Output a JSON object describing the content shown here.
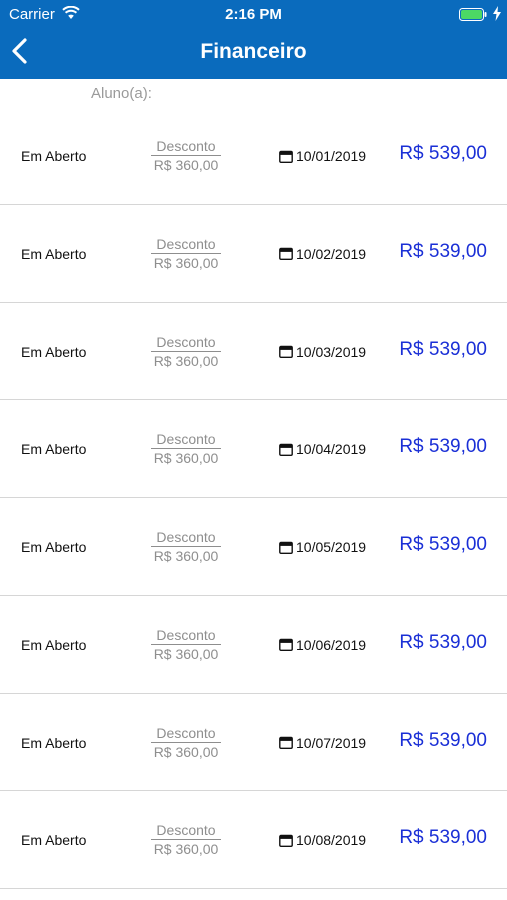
{
  "status_bar": {
    "carrier": "Carrier",
    "time": "2:16 PM"
  },
  "nav": {
    "title": "Financeiro"
  },
  "student": {
    "label": "Aluno(a):",
    "value": ""
  },
  "colors": {
    "header": "#0a6bbd",
    "amount": "#1a2fd6",
    "muted": "#8e8e8e"
  },
  "icons": [
    "wifi-icon",
    "battery-icon",
    "charge-icon",
    "back-icon",
    "calendar-icon"
  ],
  "payments": [
    {
      "status": "Em Aberto",
      "discount_label": "Desconto",
      "discount_value": "R$ 360,00",
      "date": "10/01/2019",
      "amount": "R$ 539,00"
    },
    {
      "status": "Em Aberto",
      "discount_label": "Desconto",
      "discount_value": "R$ 360,00",
      "date": "10/02/2019",
      "amount": "R$ 539,00"
    },
    {
      "status": "Em Aberto",
      "discount_label": "Desconto",
      "discount_value": "R$ 360,00",
      "date": "10/03/2019",
      "amount": "R$ 539,00"
    },
    {
      "status": "Em Aberto",
      "discount_label": "Desconto",
      "discount_value": "R$ 360,00",
      "date": "10/04/2019",
      "amount": "R$ 539,00"
    },
    {
      "status": "Em Aberto",
      "discount_label": "Desconto",
      "discount_value": "R$ 360,00",
      "date": "10/05/2019",
      "amount": "R$ 539,00"
    },
    {
      "status": "Em Aberto",
      "discount_label": "Desconto",
      "discount_value": "R$ 360,00",
      "date": "10/06/2019",
      "amount": "R$ 539,00"
    },
    {
      "status": "Em Aberto",
      "discount_label": "Desconto",
      "discount_value": "R$ 360,00",
      "date": "10/07/2019",
      "amount": "R$ 539,00"
    },
    {
      "status": "Em Aberto",
      "discount_label": "Desconto",
      "discount_value": "R$ 360,00",
      "date": "10/08/2019",
      "amount": "R$ 539,00"
    }
  ]
}
